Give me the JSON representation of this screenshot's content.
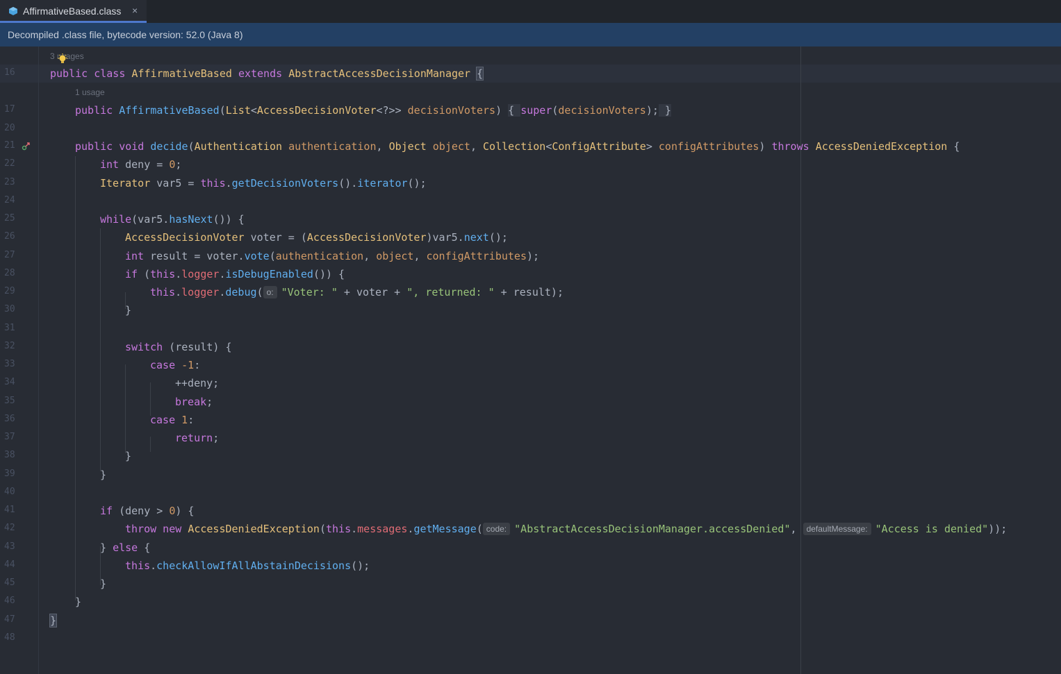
{
  "tab": {
    "label": "AffirmativeBased.class",
    "close": "×"
  },
  "banner": {
    "text": "Decompiled .class file, bytecode version: 52.0 (Java 8)"
  },
  "usages": {
    "class": "3 usages",
    "ctor": "1 usage"
  },
  "hints": {
    "o": "o:",
    "code": "code:",
    "defaultMessage": "defaultMessage:"
  },
  "strings": {
    "voter": "\"Voter: \"",
    "returned": "\", returned: \"",
    "key": "\"AbstractAccessDecisionManager.accessDenied\"",
    "denied": "\"Access is denied\""
  },
  "line_numbers": [
    "16",
    "17",
    "20",
    "21",
    "22",
    "23",
    "24",
    "25",
    "26",
    "27",
    "28",
    "29",
    "30",
    "31",
    "32",
    "33",
    "34",
    "35",
    "36",
    "37",
    "38",
    "39",
    "40",
    "41",
    "42",
    "43",
    "44",
    "45",
    "46",
    "47",
    "48"
  ],
  "colors": {
    "keyword": "#c678dd",
    "class": "#e5c07b",
    "method": "#61afef",
    "param": "#d19a66",
    "field": "#e06c75",
    "string": "#98c379"
  }
}
